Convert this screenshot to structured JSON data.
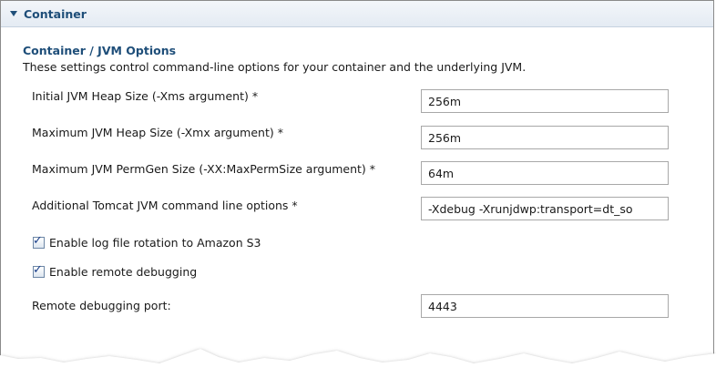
{
  "section": {
    "title": "Container",
    "expanded": true
  },
  "group": {
    "title": "Container / JVM Options",
    "description": "These settings control command-line options for your container and the underlying JVM."
  },
  "fields": [
    {
      "label": "Initial JVM Heap Size (-Xms argument) *",
      "value": "256m"
    },
    {
      "label": "Maximum JVM Heap Size (-Xmx argument) *",
      "value": "256m"
    },
    {
      "label": "Maximum JVM PermGen Size (-XX:MaxPermSize argument) *",
      "value": "64m"
    },
    {
      "label": "Additional Tomcat JVM command line options *",
      "value": "-Xdebug -Xrunjdwp:transport=dt_so"
    }
  ],
  "checkboxes": [
    {
      "label": "Enable log file rotation to Amazon S3",
      "checked": true
    },
    {
      "label": "Enable remote debugging",
      "checked": true
    }
  ],
  "remote_port": {
    "label": "Remote debugging port:",
    "value": "4443"
  },
  "colors": {
    "accent": "#1e4e79",
    "header_bg": "#e4ebf3",
    "check": "#1b3f8a"
  }
}
